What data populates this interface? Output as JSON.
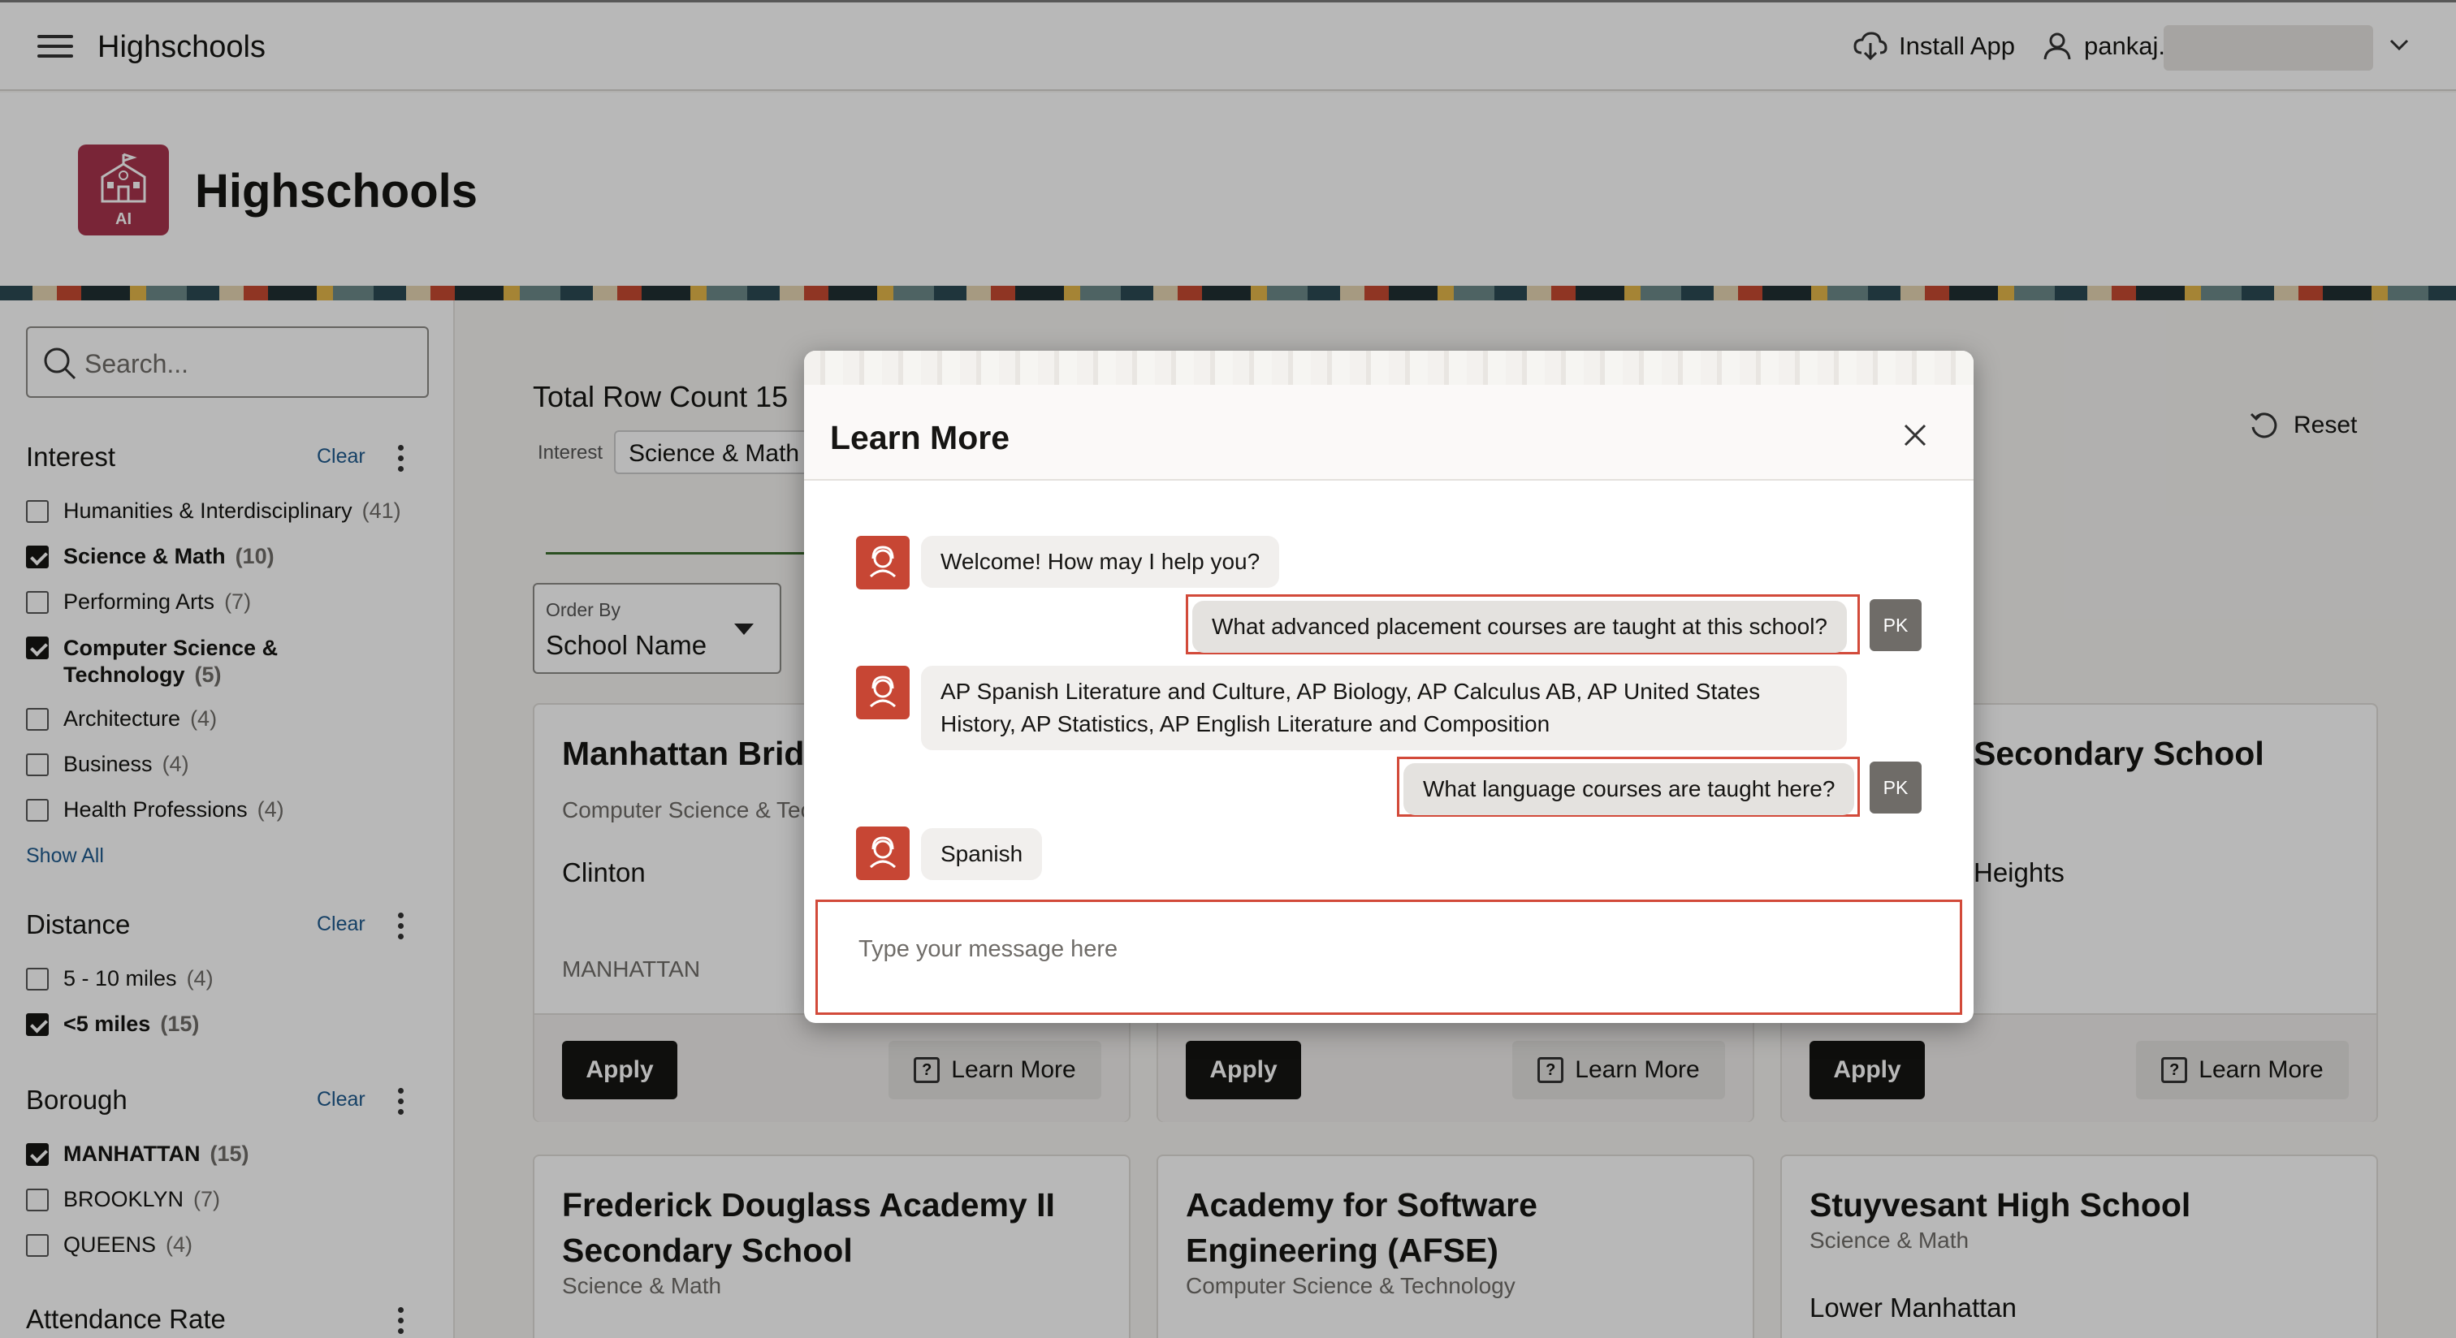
{
  "topbar": {
    "app_title": "Highschools",
    "install_label": "Install App",
    "username": "pankaj."
  },
  "header": {
    "title": "Highschools",
    "icon_badge": "AI"
  },
  "sidebar": {
    "search_placeholder": "Search...",
    "interest": {
      "title": "Interest",
      "clear": "Clear",
      "options": [
        {
          "label": "Humanities & Interdisciplinary",
          "count": "(41)",
          "checked": false
        },
        {
          "label": "Science & Math",
          "count": "(10)",
          "checked": true
        },
        {
          "label": "Performing Arts",
          "count": "(7)",
          "checked": false
        },
        {
          "label": "Computer Science & Technology",
          "count": "(5)",
          "checked": true
        },
        {
          "label": "Architecture",
          "count": "(4)",
          "checked": false
        },
        {
          "label": "Business",
          "count": "(4)",
          "checked": false
        },
        {
          "label": "Health Professions",
          "count": "(4)",
          "checked": false
        }
      ],
      "show_all": "Show All"
    },
    "distance": {
      "title": "Distance",
      "clear": "Clear",
      "options": [
        {
          "label": "5 - 10 miles",
          "count": "(4)",
          "checked": false
        },
        {
          "label": "<5 miles",
          "count": "(15)",
          "checked": true
        }
      ]
    },
    "borough": {
      "title": "Borough",
      "clear": "Clear",
      "options": [
        {
          "label": "MANHATTAN",
          "count": "(15)",
          "checked": true
        },
        {
          "label": "BROOKLYN",
          "count": "(7)",
          "checked": false
        },
        {
          "label": "QUEENS",
          "count": "(4)",
          "checked": false
        }
      ]
    },
    "attendance": {
      "title": "Attendance Rate"
    }
  },
  "main": {
    "row_count": "Total Row Count 15",
    "interest_label": "Interest",
    "interest_chip": "Science & Math",
    "reset_label": "Reset",
    "order_by_label": "Order By",
    "order_by_value": "School Name",
    "cards": [
      {
        "name": "Manhattan Brid",
        "sub": "Computer Science & Tec",
        "loc": "Clinton",
        "boro": "MANHATTAN",
        "apply": "Apply",
        "learn": "Learn More"
      },
      {
        "name": "",
        "sub": "",
        "loc": "",
        "boro": "",
        "apply": "Apply",
        "learn": "Learn More"
      },
      {
        "name": "Secondary School",
        "sub": "",
        "loc": "Heights",
        "boro": "",
        "apply": "Apply",
        "learn": "Learn More"
      },
      {
        "name": "Frederick Douglass Academy II Secondary School",
        "sub": "Science & Math"
      },
      {
        "name": "Academy for Software Engineering (AFSE)",
        "sub": "Computer Science & Technology"
      },
      {
        "name": "Stuyvesant High School",
        "sub": "Science & Math",
        "loc": "Lower Manhattan"
      }
    ]
  },
  "dialog": {
    "title": "Learn More",
    "messages": [
      {
        "from": "bot",
        "text": "Welcome! How may I help you?"
      },
      {
        "from": "user",
        "text": "What advanced placement courses are taught at this school?",
        "avatar": "PK"
      },
      {
        "from": "bot",
        "text": "AP Spanish Literature and Culture, AP Biology, AP Calculus AB, AP United States History, AP Statistics, AP English Literature and Composition"
      },
      {
        "from": "user",
        "text": "What language courses are taught here?",
        "avatar": "PK"
      },
      {
        "from": "bot",
        "text": "Spanish"
      }
    ],
    "input_placeholder": "Type your message here"
  },
  "colors": {
    "accent_red": "#c74634",
    "highlight": "#d24a3a",
    "icon_bg": "#a8344d"
  }
}
